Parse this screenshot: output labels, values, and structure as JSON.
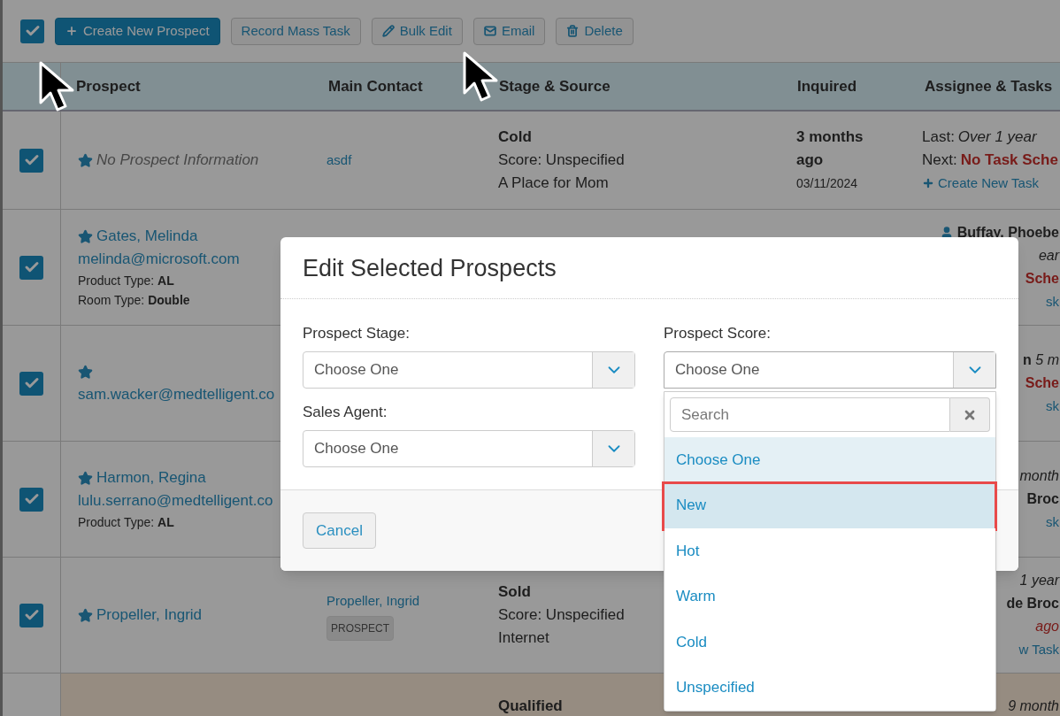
{
  "toolbar": {
    "select_all": {
      "checked": true
    },
    "buttons": [
      {
        "label": "Create New Prospect",
        "kind": "primary"
      },
      {
        "label": "Record Mass Task",
        "kind": "default"
      },
      {
        "label": "Bulk Edit",
        "kind": "default"
      },
      {
        "label": "Email",
        "kind": "default"
      },
      {
        "label": "Delete",
        "kind": "default"
      }
    ]
  },
  "table": {
    "columns": [
      "Prospect",
      "Main Contact",
      "Stage & Source",
      "Inquired",
      "Assignee & Tasks"
    ],
    "rows": [
      {
        "selected": true,
        "warning": false,
        "prospect": [
          {
            "kind": "empty",
            "text": "No Prospect Information"
          }
        ],
        "contact": [
          {
            "kind": "link",
            "text": "asdf"
          }
        ],
        "stage": [
          {
            "kind": "bold",
            "text": "Cold"
          },
          {
            "kind": "plain",
            "text": "Score: Unspecified"
          },
          {
            "kind": "plain",
            "text": "A Place for Mom"
          }
        ],
        "inquired": [
          {
            "kind": "bold",
            "text": "3 months ago"
          },
          {
            "kind": "date",
            "text": "03/11/2024"
          }
        ],
        "assignee": [
          {
            "kind": "labeled-italic",
            "label": "Last:",
            "value": "Over 1 year"
          },
          {
            "kind": "labeled-alert",
            "label": "Next:",
            "value": "No Task Sche"
          },
          {
            "kind": "add-link",
            "text": "Create New Task"
          }
        ]
      },
      {
        "selected": true,
        "warning": false,
        "prospect": [
          {
            "kind": "name",
            "text": "Gates, Melinda"
          },
          {
            "kind": "email",
            "text": "melinda@microsoft.com"
          },
          {
            "kind": "detail",
            "text": "Product Type: **AL**"
          },
          {
            "kind": "detail",
            "text": "Room Type: **Double**"
          }
        ],
        "assignee": [
          {
            "kind": "person",
            "text": "Buffay, Phoebe"
          },
          {
            "kind": "italic",
            "text": "ear"
          },
          {
            "kind": "alert",
            "text": "Sche"
          },
          {
            "kind": "link",
            "text": "sk"
          }
        ]
      },
      {
        "selected": true,
        "warning": false,
        "prospect": [
          {
            "kind": "star"
          },
          {
            "kind": "email",
            "text": "sam.wacker@medtelligent.co"
          }
        ],
        "assignee": [
          {
            "kind": "mixed",
            "text": "**n** *5 m*"
          },
          {
            "kind": "alert",
            "text": "Sche"
          },
          {
            "kind": "link",
            "text": "sk"
          }
        ]
      },
      {
        "selected": true,
        "warning": false,
        "prospect": [
          {
            "kind": "name",
            "text": "Harmon, Regina"
          },
          {
            "kind": "email",
            "text": "lulu.serrano@medtelligent.co"
          },
          {
            "kind": "detail",
            "text": "Product Type: **AL**"
          }
        ],
        "assignee": [
          {
            "kind": "italic",
            "text": "month"
          },
          {
            "kind": "bold",
            "text": "Broc"
          },
          {
            "kind": "link",
            "text": "sk"
          }
        ]
      },
      {
        "selected": true,
        "warning": false,
        "prospect": [
          {
            "kind": "name",
            "text": "Propeller, Ingrid"
          }
        ],
        "contact": [
          {
            "kind": "link",
            "text": "Propeller, Ingrid"
          },
          {
            "kind": "badge",
            "text": "PROSPECT"
          }
        ],
        "stage": [
          {
            "kind": "bold",
            "text": "Sold"
          },
          {
            "kind": "plain",
            "text": "Score: Unspecified"
          },
          {
            "kind": "plain",
            "text": "Internet"
          }
        ],
        "assignee": [
          {
            "kind": "italic",
            "text": "1 year"
          },
          {
            "kind": "bold",
            "text": "de Broc"
          },
          {
            "kind": "alert-italic",
            "text": "ago"
          },
          {
            "kind": "link",
            "text": "w Task"
          }
        ]
      },
      {
        "warning": true,
        "stage": [
          {
            "kind": "bold",
            "text": "Qualified"
          }
        ],
        "assignee": [
          {
            "kind": "italic",
            "text": "9 month"
          }
        ]
      }
    ]
  },
  "modal": {
    "title": "Edit Selected Prospects",
    "fields": [
      {
        "label": "Prospect Stage:",
        "value": "Choose One",
        "expanded": false
      },
      {
        "label": "Prospect Score:",
        "value": "Choose One",
        "expanded": true
      },
      {
        "label": "Sales Agent:",
        "value": "Choose One",
        "expanded": false
      }
    ],
    "dropdown": {
      "search": {
        "placeholder": "Search"
      },
      "options": [
        {
          "label": "Choose One",
          "selected": true,
          "highlighted": false,
          "annotated": false
        },
        {
          "label": "New",
          "selected": false,
          "highlighted": true,
          "annotated": true
        },
        {
          "label": "Hot",
          "selected": false,
          "highlighted": false,
          "annotated": false
        },
        {
          "label": "Warm",
          "selected": false,
          "highlighted": false,
          "annotated": false
        },
        {
          "label": "Cold",
          "selected": false,
          "highlighted": false,
          "annotated": false
        },
        {
          "label": "Unspecified",
          "selected": false,
          "highlighted": false,
          "annotated": false
        }
      ]
    },
    "footer_buttons": [
      "Cancel"
    ]
  }
}
